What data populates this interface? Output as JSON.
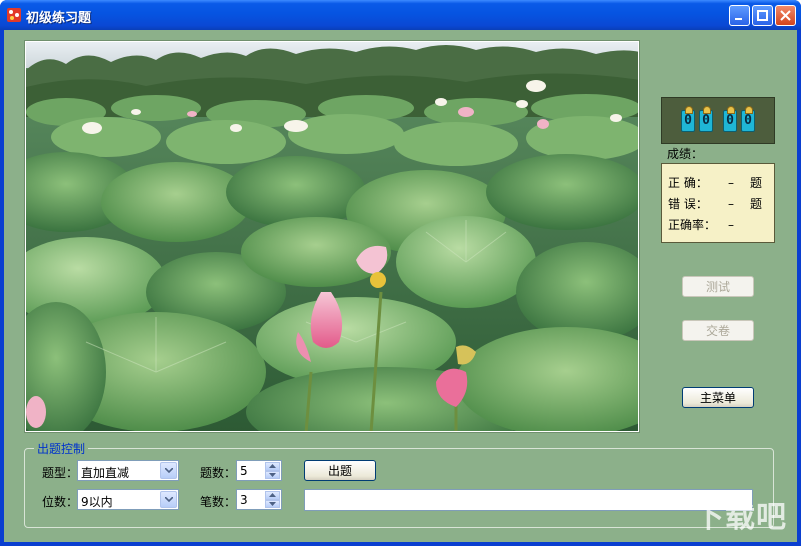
{
  "window": {
    "title": "初级练习题"
  },
  "scoreboard": {
    "digits": [
      "0",
      "0",
      "0",
      "0"
    ],
    "label": "成绩：",
    "rows": [
      {
        "key": "正  确：",
        "value": "–",
        "unit": "题"
      },
      {
        "key": "错  误：",
        "value": "–",
        "unit": "题"
      },
      {
        "key": "正确率：",
        "value": "–",
        "unit": ""
      }
    ]
  },
  "buttons": {
    "test": "测试",
    "submit": "交卷",
    "main_menu": "主菜单",
    "generate": "出题"
  },
  "control": {
    "group_title": "出题控制",
    "type_label": "题型：",
    "type_value": "直加直减",
    "digits_label": "位数：",
    "digits_value": "9以内",
    "count_label": "题数：",
    "count_value": "5",
    "strokes_label": "笔数：",
    "strokes_value": "3"
  },
  "watermark": "下载吧"
}
